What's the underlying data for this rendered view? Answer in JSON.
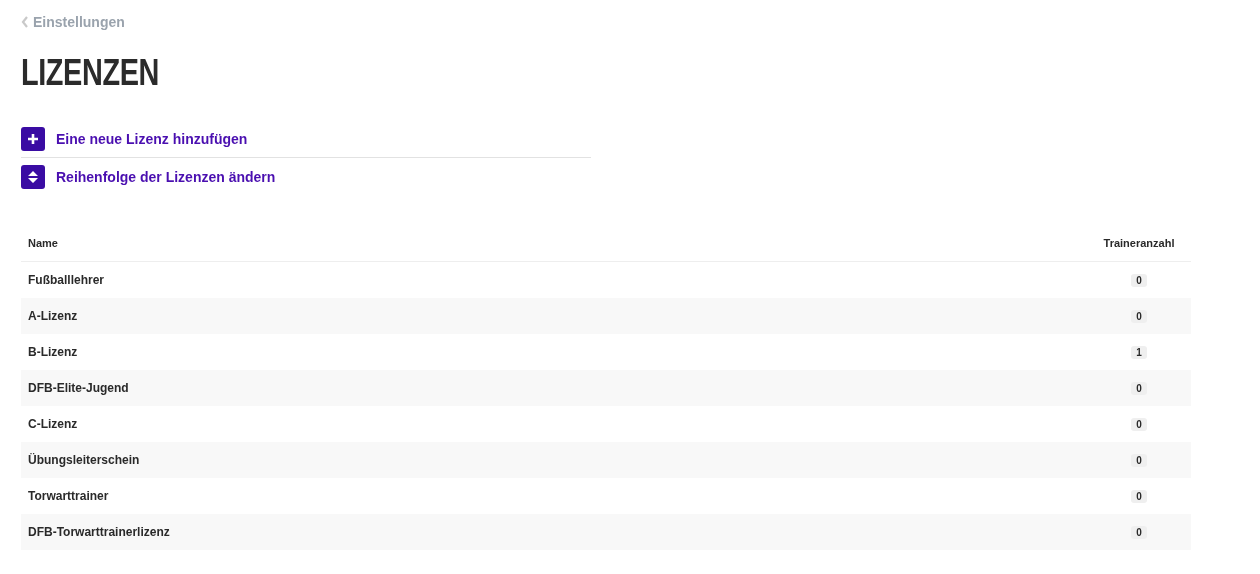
{
  "back_link": {
    "label": "Einstellungen"
  },
  "title": "LIZENZEN",
  "actions": [
    {
      "kind": "add",
      "label": "Eine neue Lizenz hinzufügen"
    },
    {
      "kind": "reorder",
      "label": "Reihenfolge der Lizenzen ändern"
    }
  ],
  "table": {
    "columns": [
      "Name",
      "Traineranzahl"
    ],
    "rows": [
      {
        "name": "Fußballlehrer",
        "count": "0"
      },
      {
        "name": "A-Lizenz",
        "count": "0"
      },
      {
        "name": "B-Lizenz",
        "count": "1"
      },
      {
        "name": "DFB-Elite-Jugend",
        "count": "0"
      },
      {
        "name": "C-Lizenz",
        "count": "0"
      },
      {
        "name": "Übungsleiterschein",
        "count": "0"
      },
      {
        "name": "Torwarttrainer",
        "count": "0"
      },
      {
        "name": "DFB-Torwarttrainerlizenz",
        "count": "0"
      }
    ]
  }
}
